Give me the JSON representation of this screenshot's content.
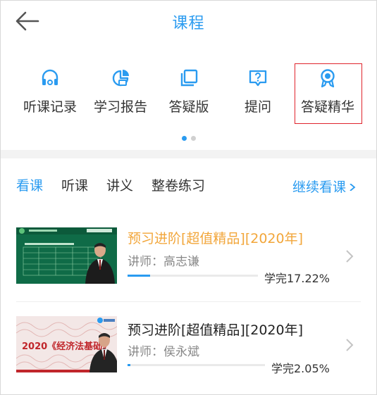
{
  "header": {
    "title": "课程",
    "back_icon": "back-arrow-icon"
  },
  "functions": [
    {
      "label": "听课记录",
      "icon": "headphones-icon"
    },
    {
      "label": "学习报告",
      "icon": "pie-chart-icon"
    },
    {
      "label": "答疑版",
      "icon": "book-layers-icon"
    },
    {
      "label": "提问",
      "icon": "question-chat-icon"
    },
    {
      "label": "答疑精华",
      "icon": "award-medal-icon"
    }
  ],
  "pager": {
    "count": 2,
    "active_index": 0
  },
  "tabs": [
    {
      "label": "看课",
      "active": true
    },
    {
      "label": "听课",
      "active": false
    },
    {
      "label": "讲义",
      "active": false
    },
    {
      "label": "整卷练习",
      "active": false
    }
  ],
  "continue_label": "继续看课",
  "courses": [
    {
      "title": "预习进阶[超值精品][2020年]",
      "teacher": "讲师：高志谦",
      "progress_text": "学完17.22%",
      "progress": 0.1722,
      "title_color": "#f2a63a"
    },
    {
      "title": "预习进阶[超值精品][2020年]",
      "teacher": "讲师：侯永斌",
      "progress_text": "学完2.05%",
      "progress": 0.0205,
      "title_color": "#222222",
      "thumb_text": "2020《经济法基础》"
    }
  ],
  "colors": {
    "accent": "#2a9bf0",
    "highlight_border": "#e0242c"
  }
}
